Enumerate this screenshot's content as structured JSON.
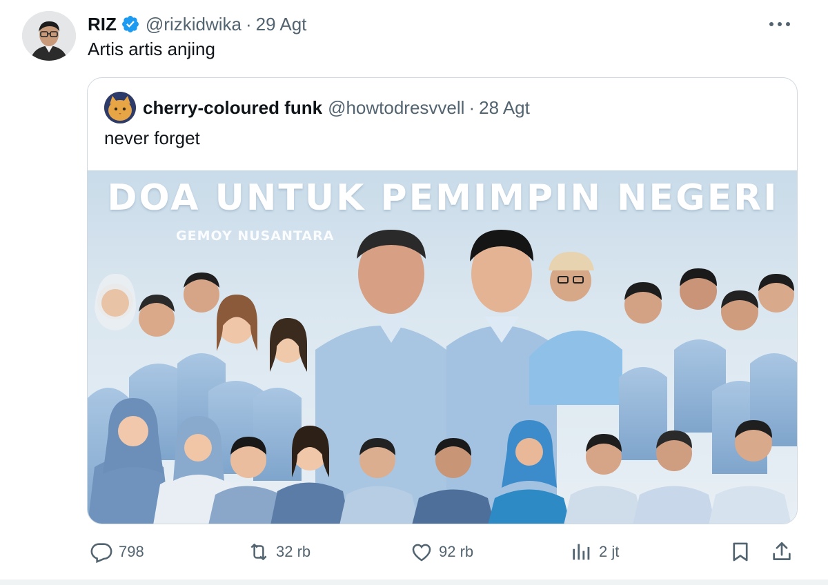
{
  "author": {
    "name": "RIZ",
    "verified": true,
    "handle": "@rizkidwika",
    "separator": "·",
    "date": "29 Agt",
    "avatar_icon": "avatar-photo"
  },
  "tweet_text": "Artis artis anjing",
  "quoted": {
    "name": "cherry-coloured funk",
    "handle": "@howtodresvvell",
    "separator": "·",
    "date": "28 Agt",
    "text": "never forget",
    "avatar_icon": "cat-avatar",
    "media": {
      "title": "DOA UNTUK PEMIMPIN NEGERI",
      "subtitle": "GEMOY NUSANTARA"
    }
  },
  "actions": {
    "reply": {
      "icon": "reply-icon",
      "count": "798"
    },
    "retweet": {
      "icon": "retweet-icon",
      "count": "32 rb"
    },
    "like": {
      "icon": "heart-icon",
      "count": "92 rb"
    },
    "views": {
      "icon": "views-icon",
      "count": "2 jt"
    },
    "bookmark": {
      "icon": "bookmark-icon"
    },
    "share": {
      "icon": "share-icon"
    }
  },
  "colors": {
    "accent": "#1d9bf0",
    "text_primary": "#0f1419",
    "text_secondary": "#536471",
    "border": "#cfd9de"
  }
}
